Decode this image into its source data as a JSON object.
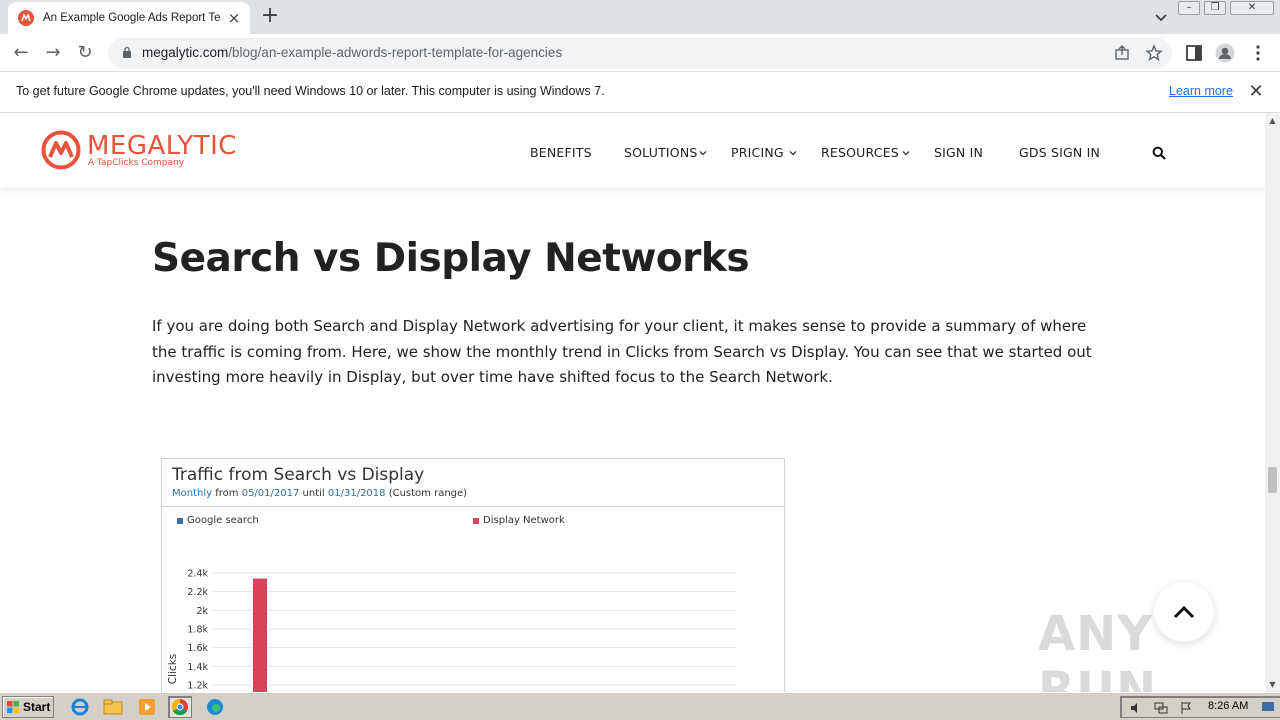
{
  "browser": {
    "tab_title": "An Example Google Ads Report Temp",
    "url_host": "megalytic.com",
    "url_path": "/blog/an-example-adwords-report-template-for-agencies"
  },
  "infobar": {
    "message": "To get future Google Chrome updates, you'll need Windows 10 or later. This computer is using Windows 7.",
    "link": "Learn more"
  },
  "site": {
    "logo_text": "MEGALYTIC",
    "logo_sub": "A TapClicks Company",
    "nav": [
      "BENEFITS",
      "SOLUTIONS",
      "PRICING",
      "RESOURCES",
      "SIGN IN",
      "GDS SIGN IN"
    ]
  },
  "article": {
    "heading": "Search vs Display Networks",
    "paragraph": "If you are doing both Search and Display Network advertising for your client, it makes sense to provide a summary of where the traffic is coming from. Here, we show the monthly trend in Clicks from Search vs Display. You can see that we started out investing more heavily in Display, but over time have shifted focus to the Search Network."
  },
  "report": {
    "title": "Traffic from Search vs Display",
    "period": "Monthly",
    "from_label": "from",
    "start": "05/01/2017",
    "until_label": "until",
    "end": "01/31/2018",
    "range_note": "(Custom range)"
  },
  "chart_data": {
    "type": "bar",
    "ylabel": "Clicks",
    "yticks": [
      "1.2k",
      "1.4k",
      "1.6k",
      "1.8k",
      "2k",
      "2.2k",
      "2.4k"
    ],
    "ylim_visible": [
      1100,
      2500
    ],
    "series": [
      {
        "name": "Google search",
        "color": "#3b6ea8",
        "values": []
      },
      {
        "name": "Display Network",
        "color": "#d9445a",
        "values": [
          2340
        ]
      }
    ]
  },
  "watermark": "ANY RUN",
  "taskbar": {
    "start_label": "Start",
    "clock": "8:26 AM"
  }
}
